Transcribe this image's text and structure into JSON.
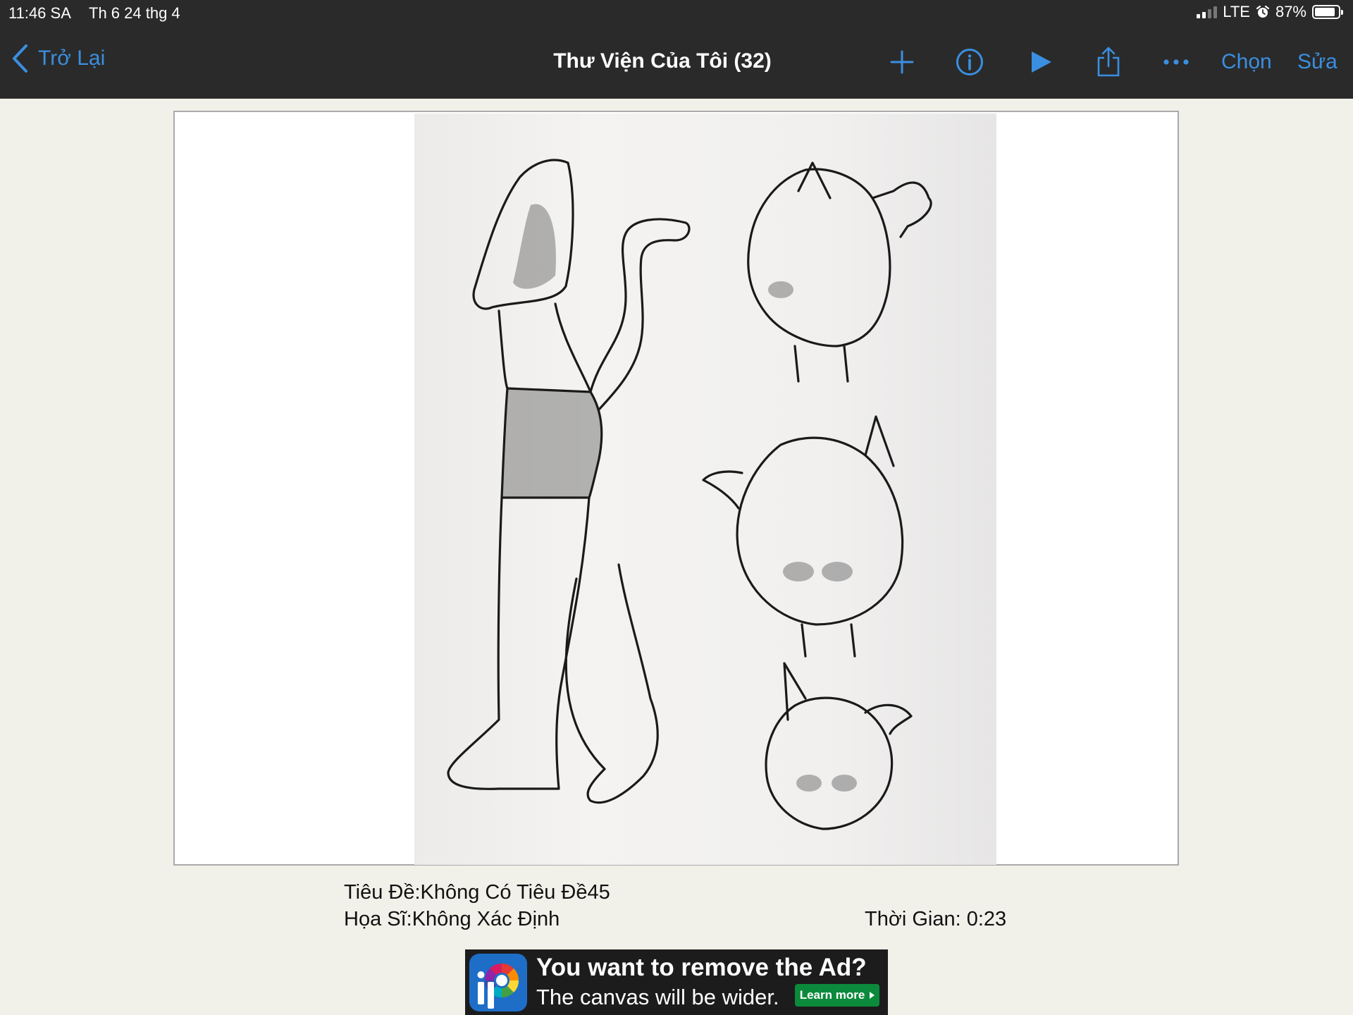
{
  "status_bar": {
    "time": "11:46 SA",
    "date": "Th 6 24 thg 4",
    "network": "LTE",
    "battery_text": "87%",
    "battery_level": 0.87,
    "alarm_icon": "alarm-clock-icon"
  },
  "nav": {
    "back_label": "Trở Lại",
    "title": "Thư Viện Của Tôi (32)",
    "select_label": "Chọn",
    "edit_label": "Sửa"
  },
  "artwork_info": {
    "title_line": "Tiêu Đề:Không Có Tiêu Đề45",
    "artist_line": "Họa Sĩ:Không Xác Định",
    "time_line": "Thời Gian:  0:23"
  },
  "ad": {
    "headline": "You want to remove the Ad?",
    "subline": "The canvas will be wider.",
    "button_label": "Learn more"
  },
  "colors": {
    "accent": "#3a8fe0",
    "bar": "#2a2a2a",
    "background": "#f2f1e9",
    "ad_button": "#0c8a3c"
  }
}
